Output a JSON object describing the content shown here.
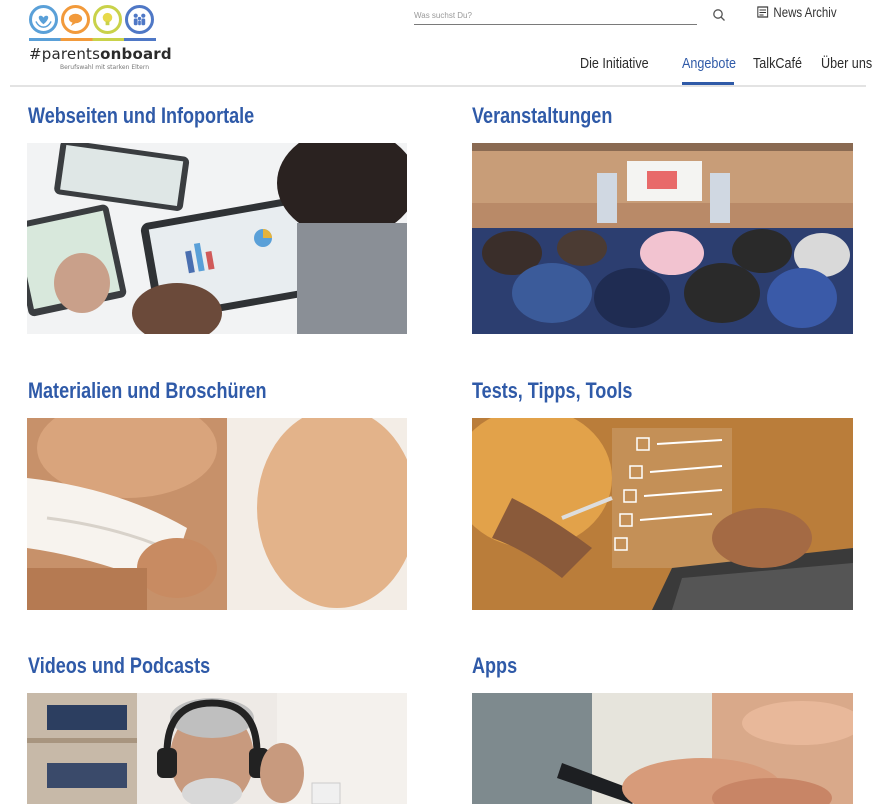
{
  "logo": {
    "name_prefix": "#parents",
    "name_bold": "onboard",
    "tagline": "Berufswahl mit starken Eltern",
    "circle_colors": [
      "#5aa0d8",
      "#f29a3b",
      "#c9d24a",
      "#4f78c6"
    ]
  },
  "search": {
    "placeholder": "Was suchst Du?"
  },
  "news": {
    "label": "News Archiv"
  },
  "nav": {
    "items": [
      {
        "label": "Die Initiative"
      },
      {
        "label": "Angebote"
      },
      {
        "label": "TalkCafé"
      },
      {
        "label": "Über uns"
      }
    ],
    "active_index": 1
  },
  "colors": {
    "accent": "#2f5aa8"
  },
  "cards": [
    {
      "title": "Webseiten und Infoportale"
    },
    {
      "title": "Veranstaltungen"
    },
    {
      "title": "Materialien und Broschüren"
    },
    {
      "title": "Tests, Tipps, Tools"
    },
    {
      "title": "Videos und Podcasts"
    },
    {
      "title": "Apps"
    }
  ]
}
